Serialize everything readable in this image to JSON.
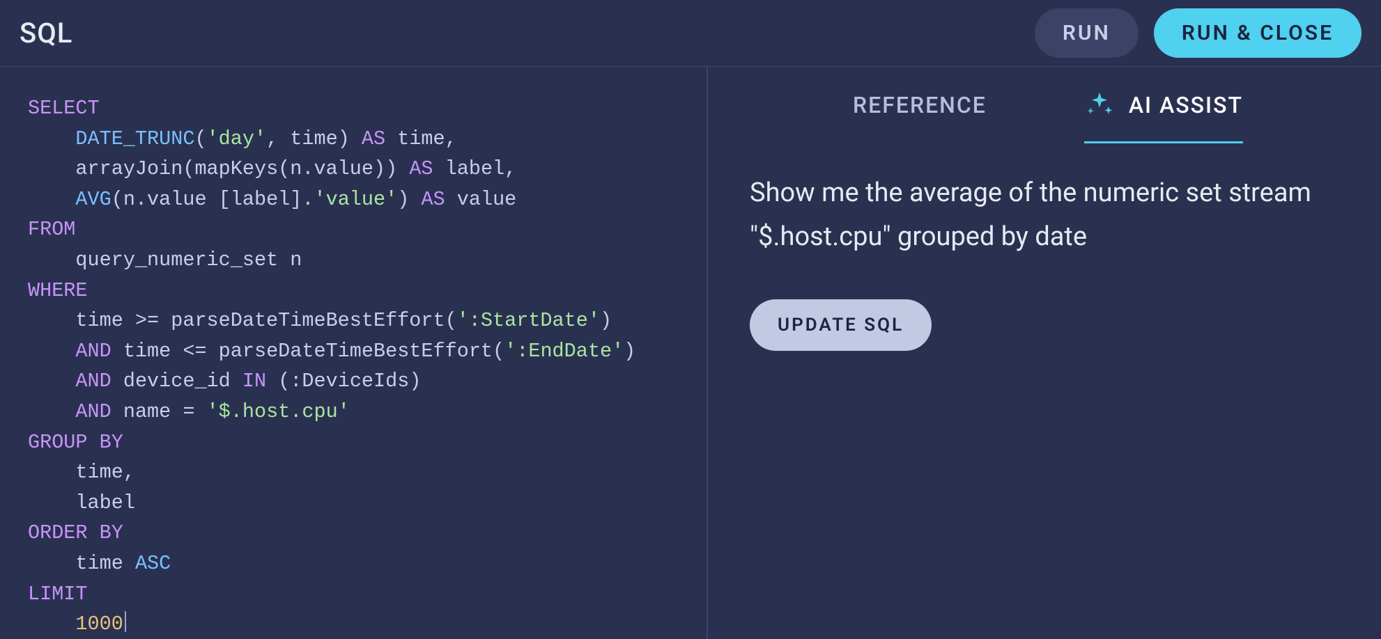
{
  "header": {
    "title": "SQL",
    "run_label": "RUN",
    "run_close_label": "RUN & CLOSE"
  },
  "tabs": {
    "reference_label": "REFERENCE",
    "ai_assist_label": "AI ASSIST",
    "active": "ai_assist"
  },
  "assist": {
    "prompt": "Show me the average of the numeric set stream \"$.host.cpu\" grouped by date",
    "update_label": "UPDATE SQL"
  },
  "sql": {
    "raw": "SELECT\n    DATE_TRUNC('day', time) AS time,\n    arrayJoin(mapKeys(n.value)) AS label,\n    AVG(n.value [label].'value') AS value\nFROM\n    query_numeric_set n\nWHERE\n    time >= parseDateTimeBestEffort(':StartDate')\n    AND time <= parseDateTimeBestEffort(':EndDate')\n    AND device_id IN (:DeviceIds)\n    AND name = '$.host.cpu'\nGROUP BY\n    time,\n    label\nORDER BY\n    time ASC\nLIMIT\n    1000",
    "tokens": [
      {
        "t": "SELECT",
        "c": "kw"
      },
      {
        "t": "\n    ",
        "c": "ident"
      },
      {
        "t": "DATE_TRUNC",
        "c": "fn"
      },
      {
        "t": "(",
        "c": "punct"
      },
      {
        "t": "'day'",
        "c": "str"
      },
      {
        "t": ", time) ",
        "c": "ident"
      },
      {
        "t": "AS",
        "c": "kw"
      },
      {
        "t": " time,",
        "c": "ident"
      },
      {
        "t": "\n    ",
        "c": "ident"
      },
      {
        "t": "arrayJoin(mapKeys(n.value)) ",
        "c": "ident"
      },
      {
        "t": "AS",
        "c": "kw"
      },
      {
        "t": " label,",
        "c": "ident"
      },
      {
        "t": "\n    ",
        "c": "ident"
      },
      {
        "t": "AVG",
        "c": "fn"
      },
      {
        "t": "(n.value [label].",
        "c": "ident"
      },
      {
        "t": "'value'",
        "c": "str"
      },
      {
        "t": ") ",
        "c": "ident"
      },
      {
        "t": "AS",
        "c": "kw"
      },
      {
        "t": " value",
        "c": "ident"
      },
      {
        "t": "\n",
        "c": "ident"
      },
      {
        "t": "FROM",
        "c": "kw"
      },
      {
        "t": "\n    query_numeric_set n\n",
        "c": "ident"
      },
      {
        "t": "WHERE",
        "c": "kw"
      },
      {
        "t": "\n    time >= parseDateTimeBestEffort(",
        "c": "ident"
      },
      {
        "t": "':StartDate'",
        "c": "str"
      },
      {
        "t": ")\n    ",
        "c": "ident"
      },
      {
        "t": "AND",
        "c": "kw"
      },
      {
        "t": " time <= parseDateTimeBestEffort(",
        "c": "ident"
      },
      {
        "t": "':EndDate'",
        "c": "str"
      },
      {
        "t": ")\n    ",
        "c": "ident"
      },
      {
        "t": "AND",
        "c": "kw"
      },
      {
        "t": " device_id ",
        "c": "ident"
      },
      {
        "t": "IN",
        "c": "kw"
      },
      {
        "t": " (:DeviceIds)\n    ",
        "c": "ident"
      },
      {
        "t": "AND",
        "c": "kw"
      },
      {
        "t": " name = ",
        "c": "ident"
      },
      {
        "t": "'$.host.cpu'",
        "c": "str"
      },
      {
        "t": "\n",
        "c": "ident"
      },
      {
        "t": "GROUP BY",
        "c": "kw"
      },
      {
        "t": "\n    time,\n    label\n",
        "c": "ident"
      },
      {
        "t": "ORDER BY",
        "c": "kw"
      },
      {
        "t": "\n    time ",
        "c": "ident"
      },
      {
        "t": "ASC",
        "c": "fn"
      },
      {
        "t": "\n",
        "c": "ident"
      },
      {
        "t": "LIMIT",
        "c": "kw"
      },
      {
        "t": "\n    ",
        "c": "ident"
      },
      {
        "t": "1000",
        "c": "num"
      }
    ]
  }
}
